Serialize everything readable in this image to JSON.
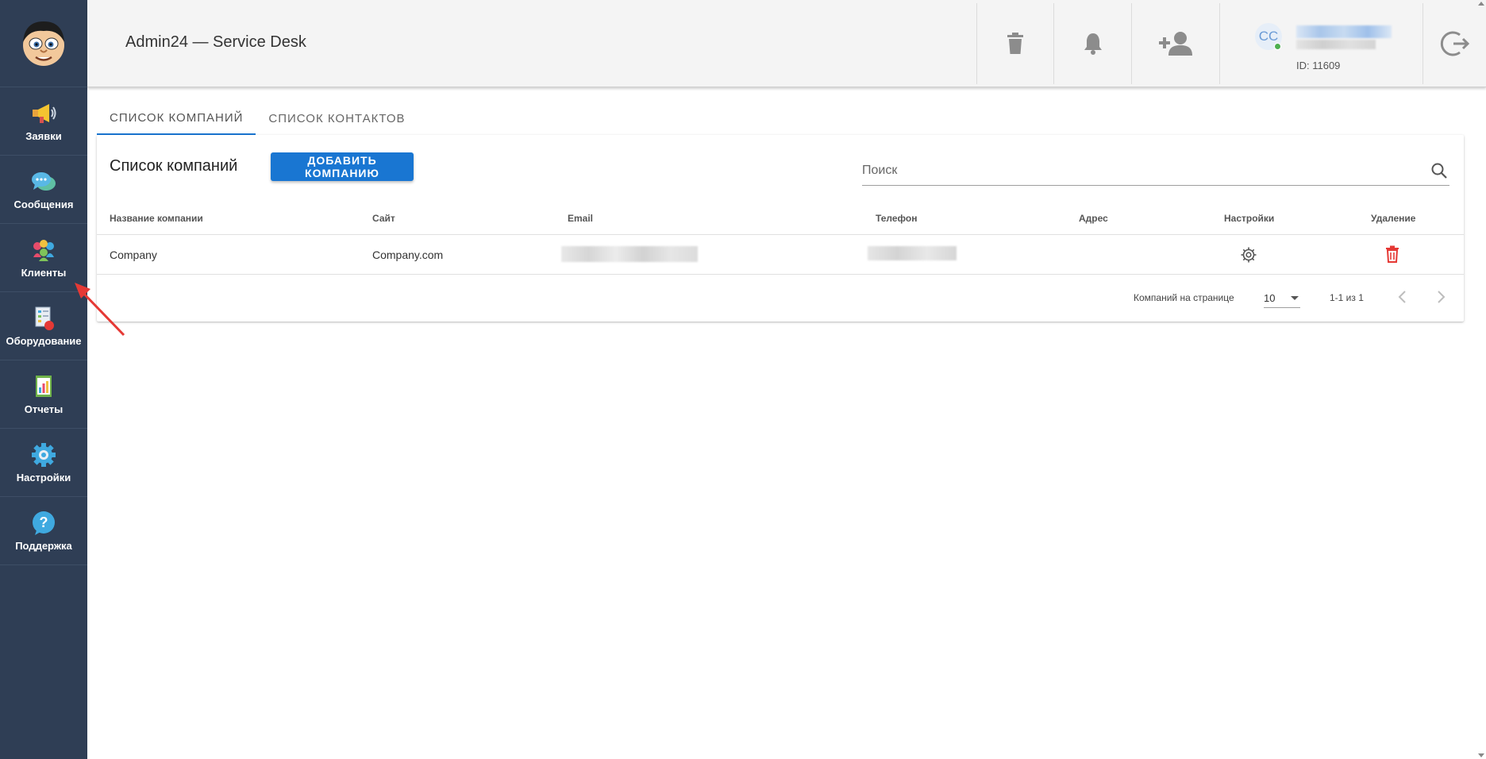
{
  "header": {
    "title": "Admin24 — Service Desk",
    "user_initials": "CC",
    "user_id": "ID: 11609"
  },
  "sidebar": {
    "items": [
      {
        "label": "Заявки",
        "icon": "megaphone-icon"
      },
      {
        "label": "Сообщения",
        "icon": "chat-icon"
      },
      {
        "label": "Клиенты",
        "icon": "clients-icon"
      },
      {
        "label": "Оборудование",
        "icon": "equipment-icon"
      },
      {
        "label": "Отчеты",
        "icon": "reports-icon"
      },
      {
        "label": "Настройки",
        "icon": "gear-icon"
      },
      {
        "label": "Поддержка",
        "icon": "help-icon"
      }
    ]
  },
  "tabs": [
    {
      "label": "СПИСОК КОМПАНИЙ",
      "active": true
    },
    {
      "label": "СПИСОК КОНТАКТОВ",
      "active": false
    }
  ],
  "companies": {
    "title": "Список компаний",
    "add_button": "ДОБАВИТЬ КОМПАНИЮ",
    "search_placeholder": "Поиск",
    "columns": [
      "Название компании",
      "Сайт",
      "Email",
      "Телефон",
      "Адрес",
      "Настройки",
      "Удаление"
    ],
    "rows": [
      {
        "name": "Company",
        "site": "Company.com",
        "email": "",
        "phone": "",
        "address": ""
      }
    ],
    "pager": {
      "per_page_label": "Компаний на странице",
      "per_page": "10",
      "range": "1-1 из 1"
    }
  },
  "colors": {
    "sidebar": "#2f3e55",
    "accent": "#1976d2",
    "delete": "#e53935",
    "annotation": "#e53935"
  }
}
